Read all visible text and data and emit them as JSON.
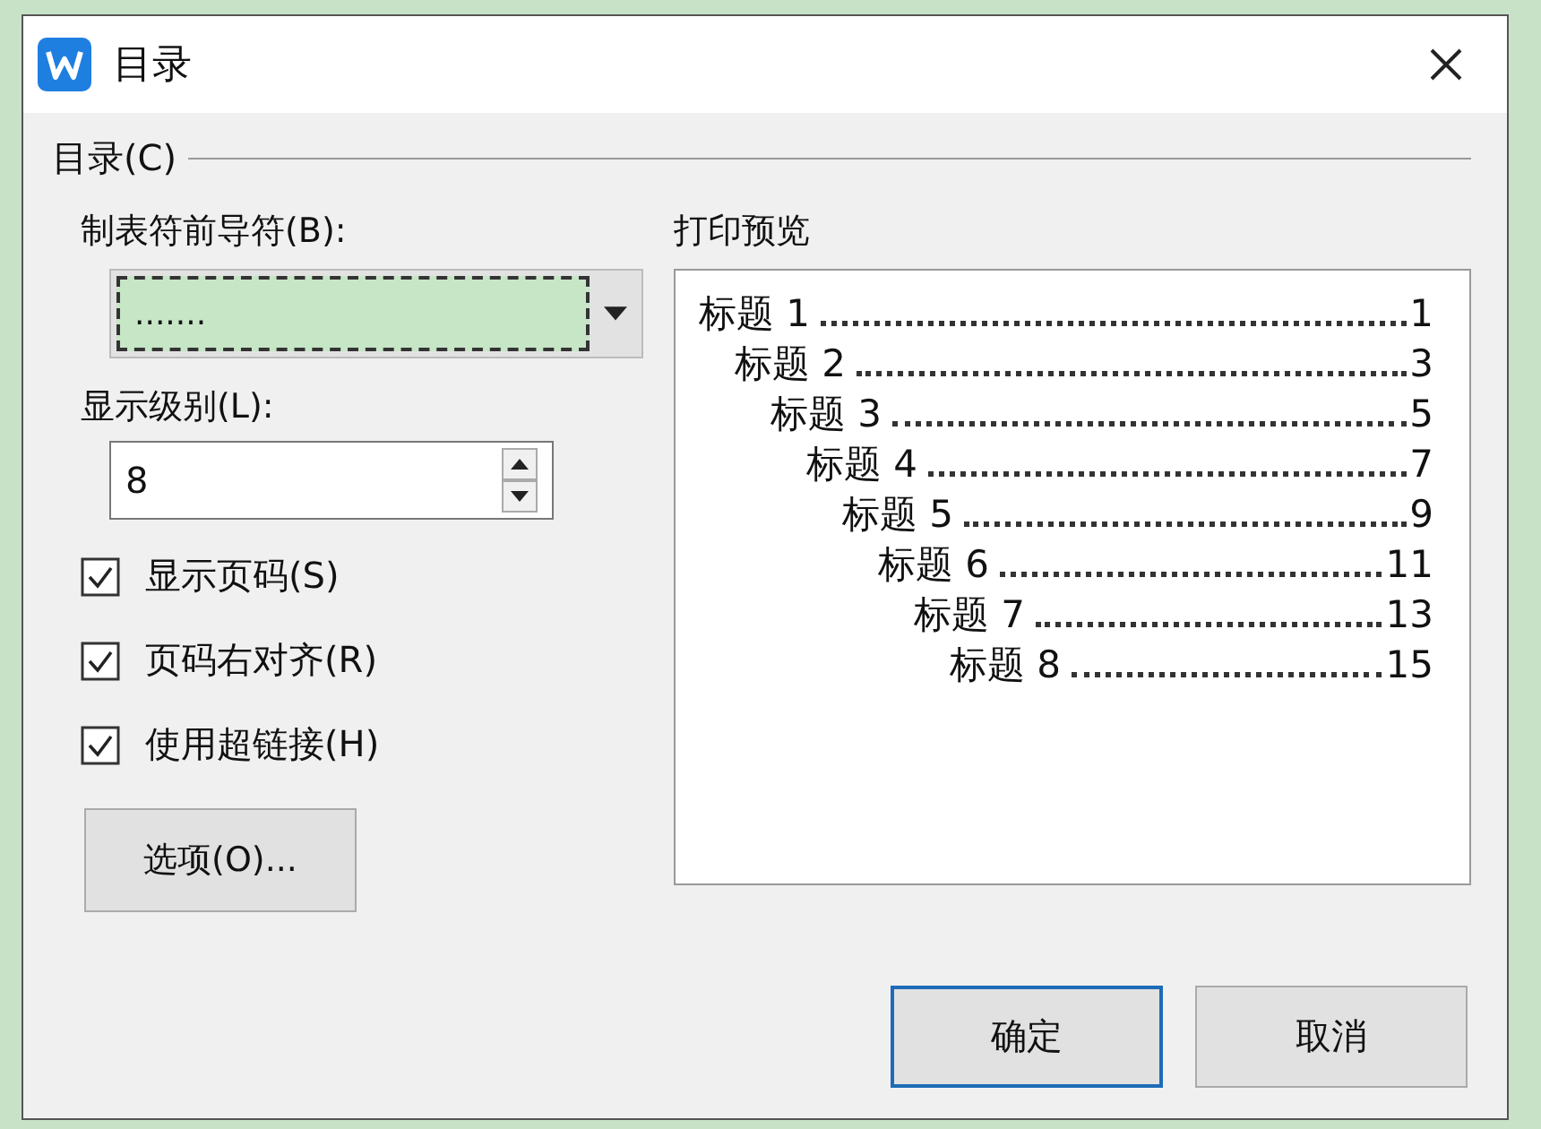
{
  "window": {
    "title": "目录"
  },
  "group": {
    "label": "目录(C)"
  },
  "leader": {
    "label": "制表符前导符(B):",
    "value": "......."
  },
  "levels": {
    "label": "显示级别(L):",
    "value": "8"
  },
  "checkboxes": [
    {
      "label": "显示页码(S)",
      "checked": true
    },
    {
      "label": "页码右对齐(R)",
      "checked": true
    },
    {
      "label": "使用超链接(H)",
      "checked": true
    }
  ],
  "options_button": "选项(O)...",
  "preview": {
    "label": "打印预览",
    "entries": [
      {
        "title": "标题 1",
        "page": "1",
        "children": [
          {
            "title": "标题 2",
            "page": "3",
            "children": [
              {
                "title": "标题 3",
                "page": "5",
                "children": [
                  {
                    "title": "标题 4",
                    "page": "7",
                    "children": [
                      {
                        "title": "标题 5",
                        "page": "9",
                        "children": [
                          {
                            "title": "标题 6",
                            "page": "11",
                            "children": [
                              {
                                "title": "标题 7",
                                "page": "13",
                                "children": [
                                  {
                                    "title": "标题 8",
                                    "page": "15"
                                  }
                                ]
                              }
                            ]
                          }
                        ]
                      }
                    ]
                  }
                ]
              }
            ]
          }
        ]
      }
    ]
  },
  "buttons": [
    {
      "label": "确定",
      "default": true
    },
    {
      "label": "取消",
      "default": false
    }
  ]
}
